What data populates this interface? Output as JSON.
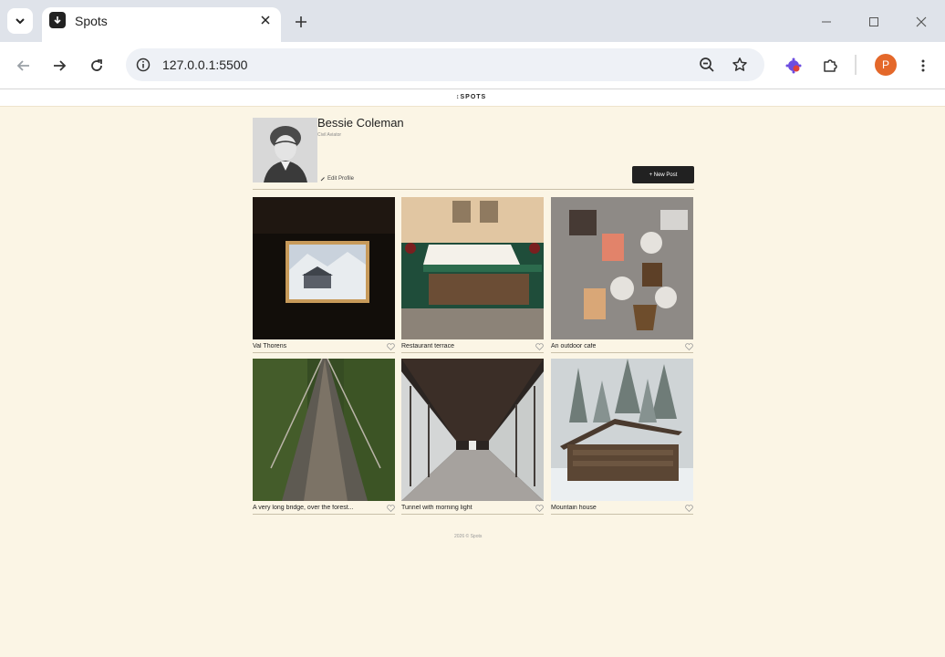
{
  "browser": {
    "tab_title": "Spots",
    "url": "127.0.0.1:5500",
    "profile_initial": "P"
  },
  "site": {
    "logo": "SPOTS",
    "footer": "2026 © Spots"
  },
  "profile": {
    "name": "Bessie Coleman",
    "description": "Civil Aviator",
    "edit_label": "Edit Profile",
    "new_post_label": "+ New Post"
  },
  "cards": [
    {
      "title": "Val Thorens"
    },
    {
      "title": "Restaurant terrace"
    },
    {
      "title": "An outdoor cafe"
    },
    {
      "title": "A very long bridge, over the forest..."
    },
    {
      "title": "Tunnel with morning light"
    },
    {
      "title": "Mountain house"
    }
  ],
  "colors": {
    "page_bg": "#fbf5e5",
    "button_bg": "#212121",
    "profile_badge": "#e4682a"
  }
}
